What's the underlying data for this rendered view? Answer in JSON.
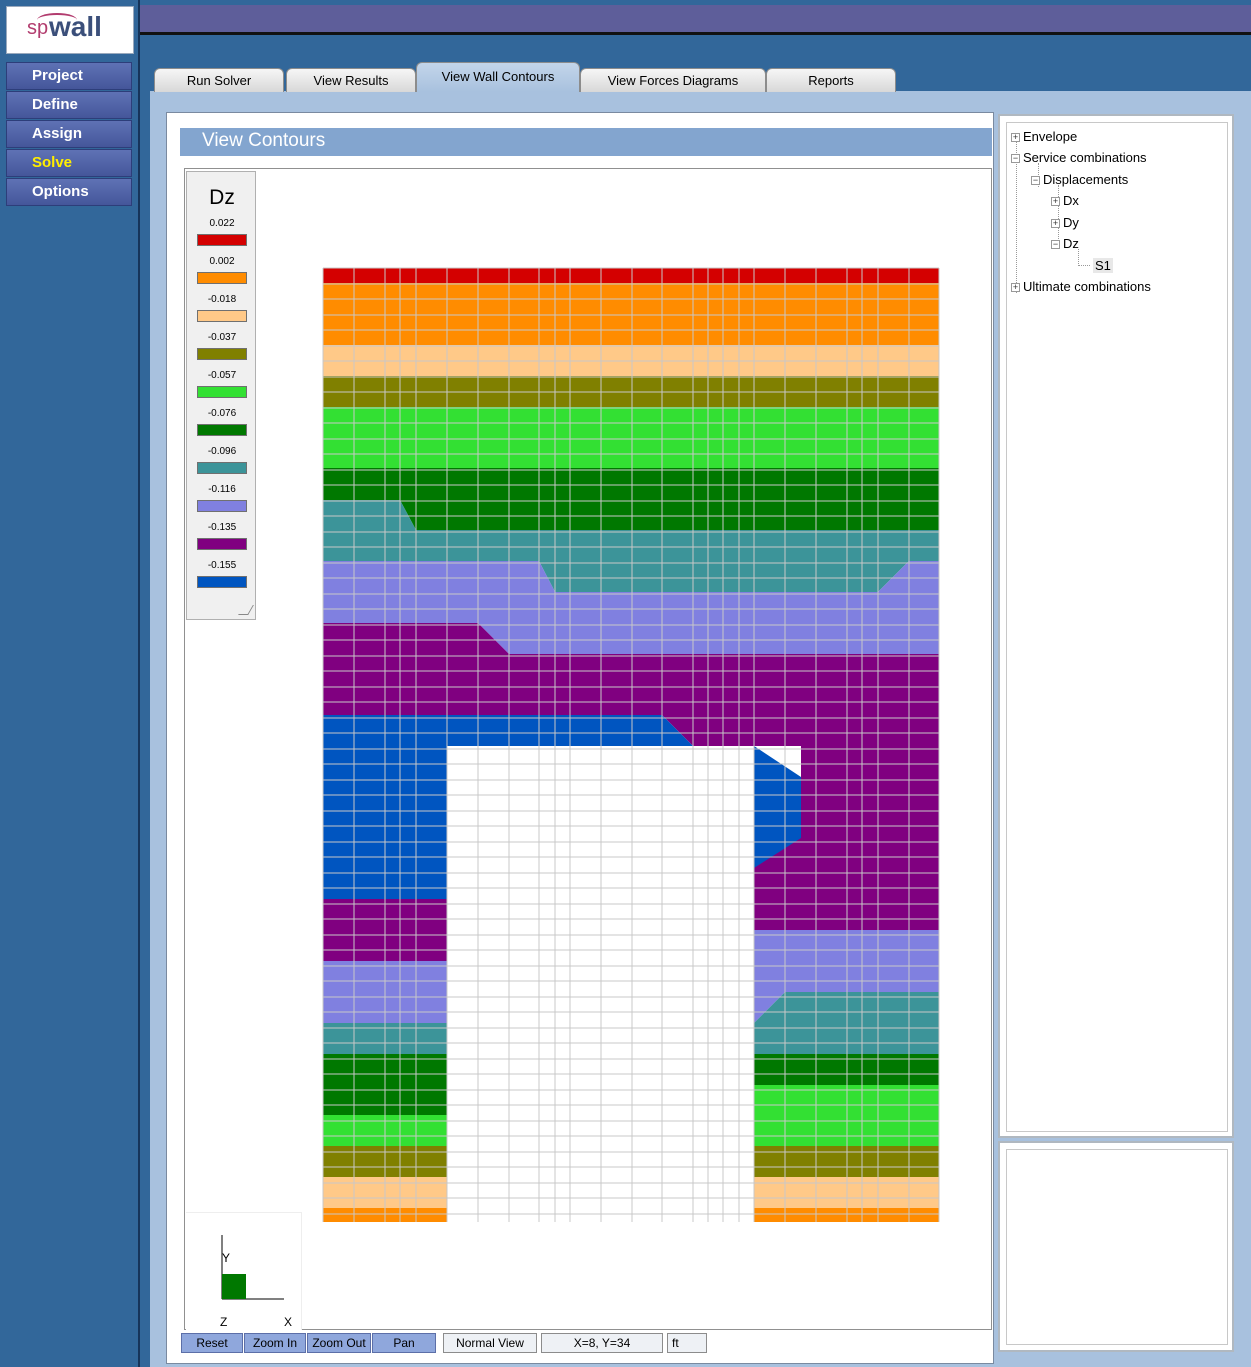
{
  "app": {
    "logo_text_sp": "sp",
    "logo_text_wall": "wall"
  },
  "sidebar": {
    "items": [
      {
        "label": "Project",
        "active": false
      },
      {
        "label": "Define",
        "active": false
      },
      {
        "label": "Assign",
        "active": false
      },
      {
        "label": "Solve",
        "active": true
      },
      {
        "label": "Options",
        "active": false
      }
    ]
  },
  "tabs": [
    {
      "label": "Run Solver",
      "active": false
    },
    {
      "label": "View Results",
      "active": false
    },
    {
      "label": "View Wall Contours",
      "active": true
    },
    {
      "label": "View Forces Diagrams",
      "active": false
    },
    {
      "label": "Reports",
      "active": false
    }
  ],
  "view": {
    "title": "View Contours"
  },
  "legend": {
    "title": "Dz",
    "entries": [
      {
        "value": "0.022",
        "color": "#d40000"
      },
      {
        "value": "0.002",
        "color": "#ff8c00"
      },
      {
        "value": "-0.018",
        "color": "#ffc988"
      },
      {
        "value": "-0.037",
        "color": "#808000"
      },
      {
        "value": "-0.057",
        "color": "#33e033"
      },
      {
        "value": "-0.076",
        "color": "#007800"
      },
      {
        "value": "-0.096",
        "color": "#3c9499"
      },
      {
        "value": "-0.116",
        "color": "#8080e0"
      },
      {
        "value": "-0.135",
        "color": "#800080"
      },
      {
        "value": "-0.155",
        "color": "#0055c0"
      }
    ]
  },
  "axes": {
    "y_label": "Y",
    "z_label": "Z",
    "x_label": "X"
  },
  "toolbar": {
    "reset": "Reset",
    "zoom_in": "Zoom In",
    "zoom_out": "Zoom Out",
    "pan": "Pan",
    "view_mode": "Normal View",
    "coords": "X=8, Y=34",
    "units": "ft"
  },
  "tree": {
    "envelope": "Envelope",
    "service": "Service combinations",
    "displacements": "Displacements",
    "dx": "Dx",
    "dy": "Dy",
    "dz": "Dz",
    "s1": "S1",
    "ultimate": "Ultimate combinations"
  }
}
